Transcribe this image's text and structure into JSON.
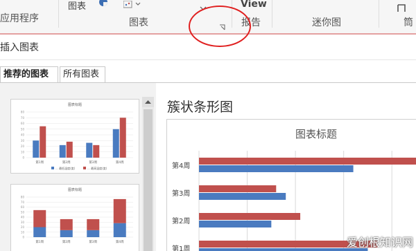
{
  "ribbon": {
    "group_app": "应用程序",
    "group_charts": "图表",
    "chart_button": "图表",
    "view_label": "View",
    "group_report": "报告",
    "group_sparklines": "迷你图",
    "partial_right": "筒"
  },
  "dialog": {
    "title": "插入图表",
    "tabs": [
      {
        "label": "推荐的图表",
        "active": true
      },
      {
        "label": "所有图表",
        "active": false
      }
    ]
  },
  "thumbnails": [
    {
      "title": "图表标题",
      "type": "clustered-column",
      "categories": [
        "第1周",
        "第2周",
        "第3周",
        "第4周"
      ],
      "series": [
        {
          "values": [
            30,
            22,
            26,
            50
          ],
          "color": "#4a7bc0"
        },
        {
          "values": [
            55,
            28,
            22,
            70
          ],
          "color": "#c0504d"
        }
      ],
      "legend": [
        "... 最低温度(度)",
        "... 最高温度(度)"
      ]
    },
    {
      "title": "图表标题",
      "type": "stacked-column",
      "categories": [
        "第1周",
        "第2周",
        "第3周",
        "第4周"
      ],
      "series": [
        {
          "values": [
            20,
            14,
            14,
            28
          ],
          "color": "#4a7bc0"
        },
        {
          "values": [
            34,
            22,
            22,
            48
          ],
          "color": "#c0504d"
        }
      ]
    }
  ],
  "preview": {
    "heading": "簇状条形图",
    "chart_title": "图表标题"
  },
  "chart_data": {
    "type": "bar",
    "orientation": "horizontal",
    "title": "图表标题",
    "categories": [
      "第4周",
      "第3周",
      "第2周",
      "第1周"
    ],
    "series": [
      {
        "values": [
          46,
          16,
          21,
          37
        ],
        "color": "#c0504d"
      },
      {
        "values": [
          32,
          18,
          15,
          35
        ],
        "color": "#4a7bc0"
      }
    ],
    "grid": true
  },
  "watermark": "爱创根知识网",
  "colors": {
    "accent_red": "#e02020",
    "series_blue": "#4a7bc0",
    "series_red": "#c0504d"
  }
}
